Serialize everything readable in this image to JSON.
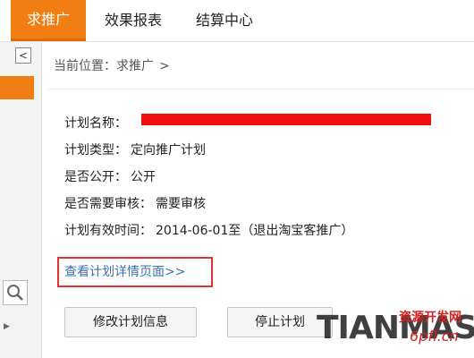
{
  "nav": {
    "tabs": [
      {
        "label": "求推广",
        "active": true
      },
      {
        "label": "效果报表",
        "active": false
      },
      {
        "label": "结算中心",
        "active": false
      }
    ]
  },
  "sidebar": {
    "collapse_glyph": "<"
  },
  "breadcrumb": {
    "prefix": "当前位置：",
    "current": "求推广",
    "separator": ">"
  },
  "plan": {
    "name_label": "计划名称：",
    "type_label": "计划类型：",
    "type_value": "定向推广计划",
    "public_label": "是否公开：",
    "public_value": "公开",
    "review_label": "是否需要审核：",
    "review_value": "需要审核",
    "period_label": "计划有效时间：",
    "period_value": "2014-06-01至（退出淘宝客推广）"
  },
  "links": {
    "detail": "查看计划详情页面>>"
  },
  "buttons": {
    "edit": "修改计划信息",
    "stop": "停止计划"
  },
  "watermark": {
    "big": "TIANMAS",
    "cn": "资源开发网",
    "url": "6pfl.cn"
  },
  "colors": {
    "accent": "#f07e13",
    "redaction": "#ee1111",
    "highlight_border": "#e83030",
    "link": "#3b6fb2"
  }
}
